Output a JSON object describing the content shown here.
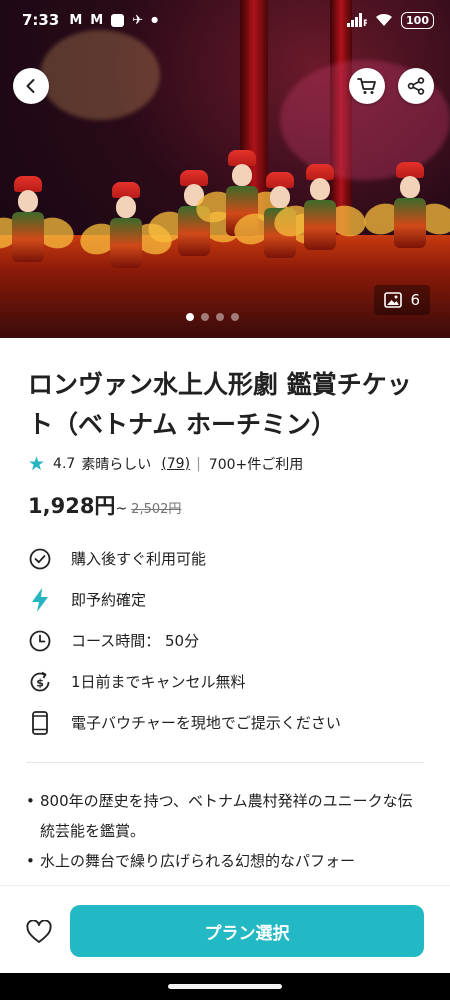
{
  "status_bar": {
    "time": "7:33",
    "battery": "100"
  },
  "hero": {
    "photo_count": "6",
    "pages": 4,
    "active_page": 0
  },
  "product": {
    "title": "ロンヴァン水上人形劇 鑑賞チケット（ベトナム ホーチミン）",
    "rating": "4.7",
    "rating_label": "素晴らしい",
    "review_count": "(79)",
    "booked": "700+件ご利用",
    "price": "1,928円",
    "price_suffix": "~",
    "original_price": "2,502円"
  },
  "features": [
    {
      "icon": "check-circle-icon",
      "label": "購入後すぐ利用可能"
    },
    {
      "icon": "lightning-icon",
      "label": "即予約確定"
    },
    {
      "icon": "clock-icon",
      "label": "コース時間： 50分"
    },
    {
      "icon": "refund-icon",
      "label": "1日前までキャンセル無料"
    },
    {
      "icon": "phone-icon",
      "label": "電子バウチャーを現地でご提示ください"
    }
  ],
  "highlights": [
    "800年の歴史を持つ、ベトナム農村発祥のユニークな伝統芸能を鑑賞。",
    "水上の舞台で繰り広げられる幻想的なパフォー"
  ],
  "bottom": {
    "plan_button": "プラン選択"
  },
  "colors": {
    "accent": "#22b9c4",
    "star": "#26b5c0"
  }
}
